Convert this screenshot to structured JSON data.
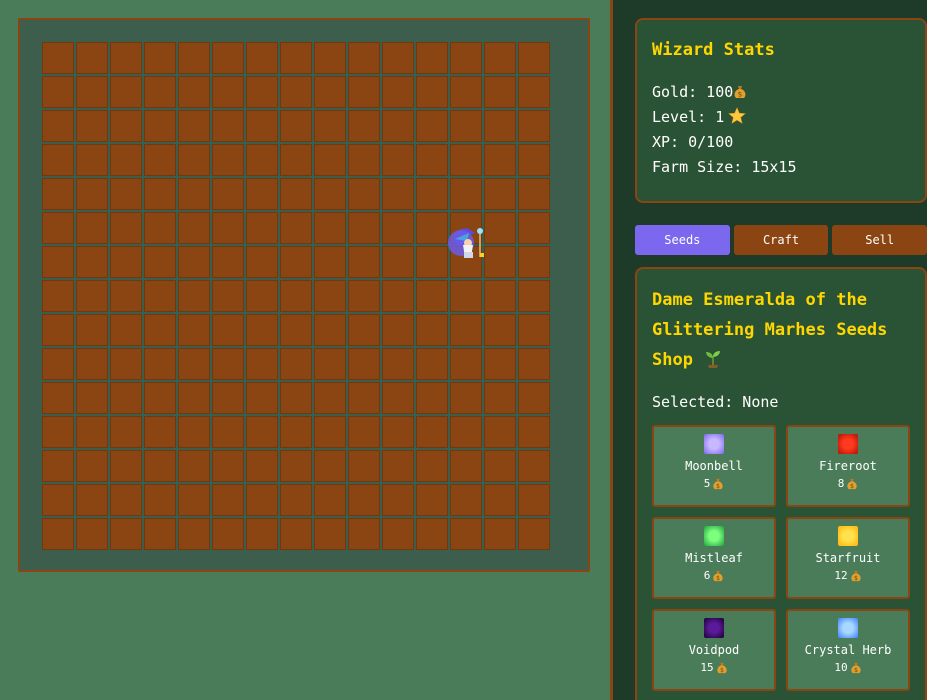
{
  "farm": {
    "rows": 15,
    "cols": 15,
    "wizard_cell": {
      "row": 6,
      "col": 12
    }
  },
  "stats": {
    "title": "Wizard Stats",
    "gold_label": "Gold: 100",
    "level_label": "Level: 1",
    "xp_label": "XP: 0/100",
    "farm_size_label": "Farm Size: 15x15"
  },
  "tabs": [
    {
      "label": "Seeds",
      "active": true
    },
    {
      "label": "Craft",
      "active": false
    },
    {
      "label": "Sell",
      "active": false
    }
  ],
  "shop": {
    "title": "Dame Esmeralda of the Glittering Marhes Seeds Shop",
    "selected_label": "Selected: None",
    "seeds": [
      {
        "name": "Moonbell",
        "cost": "5",
        "color": "#c8b8ff",
        "glow": "#7b68ee"
      },
      {
        "name": "Fireroot",
        "cost": "8",
        "color": "#ff3b1f",
        "glow": "#b01000"
      },
      {
        "name": "Mistleaf",
        "cost": "6",
        "color": "#7dff7d",
        "glow": "#1f9f3f"
      },
      {
        "name": "Starfruit",
        "cost": "12",
        "color": "#ffe14d",
        "glow": "#ffb000"
      },
      {
        "name": "Voidpod",
        "cost": "15",
        "color": "#5a1a9a",
        "glow": "#1a0030"
      },
      {
        "name": "Crystal Herb",
        "cost": "10",
        "color": "#a8d8ff",
        "glow": "#3f7fff"
      }
    ]
  },
  "colors": {
    "soil": "#8b4513",
    "accent": "#7b68ee",
    "gold_text": "#ffd700",
    "panel": "#2a5234"
  },
  "icons": {
    "currency": "money-bag-icon",
    "level": "star-icon",
    "shop": "sprout-icon",
    "player": "wizard-icon"
  }
}
